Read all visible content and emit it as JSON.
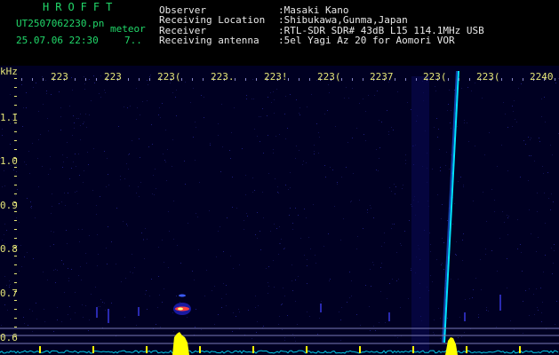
{
  "header": {
    "title": "HROFFT",
    "filename": "UT2507062230.pn",
    "event_label": "meteor",
    "timestamp": "25.07.06 22:30",
    "count": "7..",
    "fields": [
      {
        "label": "Observer",
        "value": ":Masaki Kano"
      },
      {
        "label": "Receiving Location",
        "value": ":Shibukawa,Gunma,Japan"
      },
      {
        "label": "Receiver",
        "value": ":RTL-SDR SDR# 43dB L15 114.1MHz USB"
      },
      {
        "label": "Receiving antenna",
        "value": ":5el Yagi Az 20 for Aomori VOR"
      }
    ]
  },
  "axes": {
    "y_unit": "kHz",
    "y_ticks": [
      "1.1",
      "1.0",
      "0.9",
      "0.8",
      "0.7",
      "0.6"
    ],
    "x_ticks": [
      "223",
      "223",
      "223(",
      "223.",
      "223!",
      "223(",
      "2237",
      "223(",
      "223(",
      "2240"
    ]
  },
  "colors": {
    "background": "#000022",
    "text_green": "#21d86a",
    "tick_yellow": "#e6e678",
    "trace_cyan": "#00e5ff",
    "burst_yellow": "#ffff00"
  }
}
